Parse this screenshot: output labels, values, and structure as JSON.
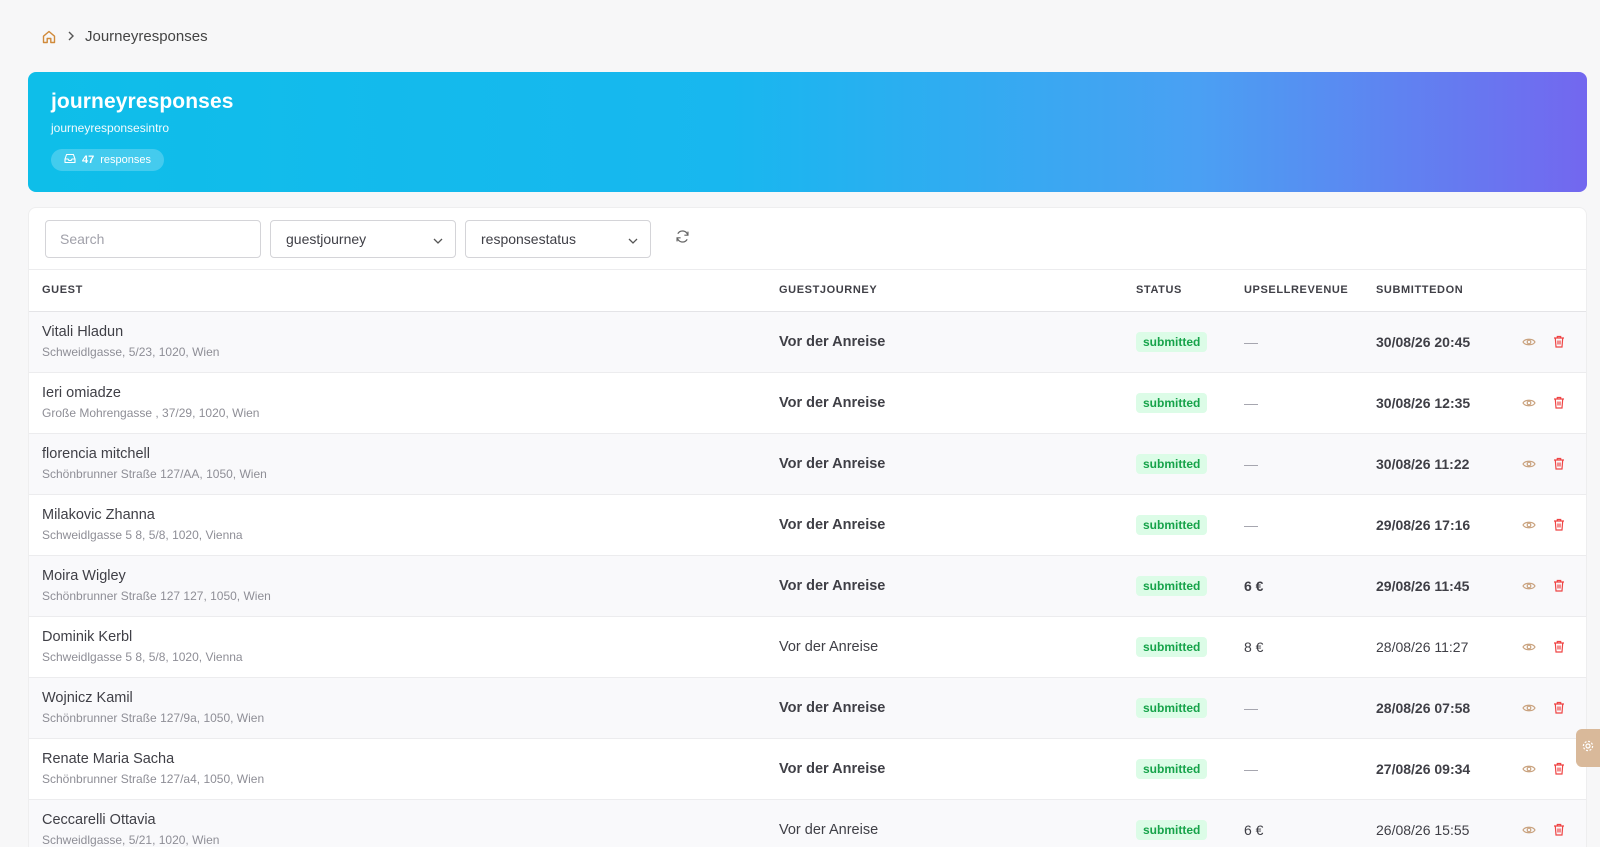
{
  "breadcrumb": {
    "home_icon": "home-icon",
    "separator_icon": "chevron-right-icon",
    "current": "Journeyresponses"
  },
  "hero": {
    "title": "journeyresponses",
    "intro": "journeyresponsesintro",
    "count": "47",
    "count_label": "responses",
    "badge_icon": "inbox-icon"
  },
  "toolbar": {
    "search_placeholder": "Search",
    "journey_select": "guestjourney",
    "status_select": "responsestatus",
    "refresh_icon": "refresh-icon"
  },
  "table": {
    "headers": {
      "guest": "GUEST",
      "journey": "GUESTJOURNEY",
      "status": "STATUS",
      "revenue": "UPSELLREVENUE",
      "submitted": "SUBMITTEDON"
    },
    "rows": [
      {
        "name": "Vitali Hladun",
        "address": "Schweidlgasse, 5/23, 1020, Wien",
        "journey": "Vor der Anreise",
        "status": "submitted",
        "revenue": "—",
        "date": "30/08/26 20:45"
      },
      {
        "name": "Ieri omiadze",
        "address": "Große Mohrengasse , 37/29, 1020, Wien",
        "journey": "Vor der Anreise",
        "status": "submitted",
        "revenue": "—",
        "date": "30/08/26 12:35"
      },
      {
        "name": "florencia mitchell",
        "address": "Schönbrunner Straße 127/AA, 1050, Wien",
        "journey": "Vor der Anreise",
        "status": "submitted",
        "revenue": "—",
        "date": "30/08/26 11:22"
      },
      {
        "name": "Milakovic Zhanna",
        "address": "Schweidlgasse 5 8, 5/8, 1020, Vienna",
        "journey": "Vor der Anreise",
        "status": "submitted",
        "revenue": "—",
        "date": "29/08/26 17:16"
      },
      {
        "name": "Moira Wigley",
        "address": "Schönbrunner Straße 127 127, 1050, Wien",
        "journey": "Vor der Anreise",
        "status": "submitted",
        "revenue": "6 €",
        "date": "29/08/26 11:45"
      },
      {
        "name": "Dominik Kerbl",
        "address": "Schweidlgasse 5 8, 5/8, 1020, Vienna",
        "journey": "Vor der Anreise",
        "status": "submitted",
        "revenue": "8 €",
        "date": "28/08/26 11:27"
      },
      {
        "name": "Wojnicz Kamil",
        "address": "Schönbrunner Straße 127/9a, 1050, Wien",
        "journey": "Vor der Anreise",
        "status": "submitted",
        "revenue": "—",
        "date": "28/08/26 07:58"
      },
      {
        "name": "Renate Maria Sacha",
        "address": "Schönbrunner Straße 127/a4, 1050, Wien",
        "journey": "Vor der Anreise",
        "status": "submitted",
        "revenue": "—",
        "date": "27/08/26 09:34"
      },
      {
        "name": "Ceccarelli Ottavia",
        "address": "Schweidlgasse, 5/21, 1020, Wien",
        "journey": "Vor der Anreise",
        "status": "submitted",
        "revenue": "6 €",
        "date": "26/08/26 15:55"
      }
    ],
    "row_style": [
      "bold",
      "bold",
      "bold",
      "bold",
      "bold",
      "normal",
      "bold",
      "bold",
      "normal"
    ],
    "view_icon": "eye-icon",
    "delete_icon": "trash-icon"
  },
  "side_tab_icon": "gear-icon",
  "colors": {
    "gradient_start": "#0ebee9",
    "gradient_end": "#7367ef",
    "status_bg": "#dcfce7",
    "status_text": "#16a34a",
    "view_icon": "#c9a27e",
    "delete_icon": "#ef4444"
  }
}
